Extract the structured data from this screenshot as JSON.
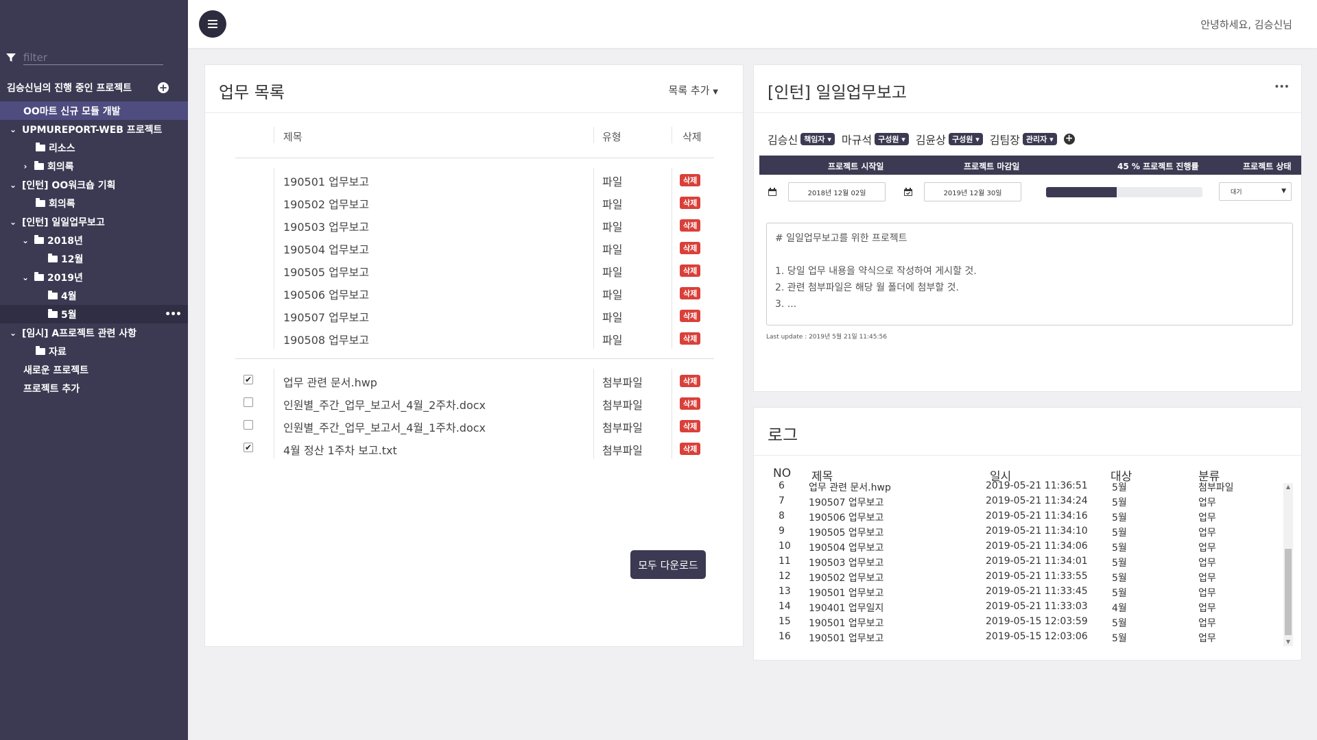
{
  "sidebar": {
    "filter_placeholder": "filter",
    "projects_header": "김승신님의 진행 중인 프로젝트",
    "tree": [
      {
        "label": "OO마트 신규 모듈 개발"
      },
      {
        "label": "UPMUREPORT-WEB 프로젝트"
      },
      {
        "label": "리소스"
      },
      {
        "label": "회의록"
      },
      {
        "label": "[인턴] OO워크숍 기획"
      },
      {
        "label": "회의록"
      },
      {
        "label": "[인턴] 일일업무보고"
      },
      {
        "label": "2018년"
      },
      {
        "label": "12월"
      },
      {
        "label": "2019년"
      },
      {
        "label": "4월"
      },
      {
        "label": "5월"
      },
      {
        "label": "[임시] A프로젝트 관련 사항"
      },
      {
        "label": "자료"
      },
      {
        "label": "새로운 프로젝트"
      },
      {
        "label": "프로젝트 추가"
      }
    ]
  },
  "topbar": {
    "greeting": "안녕하세요, 김승신님"
  },
  "list_panel": {
    "title": "업무 목록",
    "add_label": "목록 추가",
    "columns": {
      "name": "제목",
      "type": "유형",
      "delete": "삭제"
    },
    "delete_label": "삭제",
    "reports": [
      {
        "name": "190501 업무보고",
        "type": "파일"
      },
      {
        "name": "190502 업무보고",
        "type": "파일"
      },
      {
        "name": "190503 업무보고",
        "type": "파일"
      },
      {
        "name": "190504 업무보고",
        "type": "파일"
      },
      {
        "name": "190505 업무보고",
        "type": "파일"
      },
      {
        "name": "190506 업무보고",
        "type": "파일"
      },
      {
        "name": "190507 업무보고",
        "type": "파일"
      },
      {
        "name": "190508 업무보고",
        "type": "파일"
      }
    ],
    "attachments": [
      {
        "name": "업무 관련 문서.hwp",
        "type": "첨부파일",
        "checked": true
      },
      {
        "name": "인원별_주간_업무_보고서_4월_2주차.docx",
        "type": "첨부파일",
        "checked": false
      },
      {
        "name": "인원별_주간_업무_보고서_4월_1주차.docx",
        "type": "첨부파일",
        "checked": false
      },
      {
        "name": "4월 정산 1주차 보고.txt",
        "type": "첨부파일",
        "checked": true
      }
    ],
    "download_all": "모두 다운로드"
  },
  "detail_panel": {
    "title": "[인턴] 일일업무보고",
    "members": [
      {
        "name": "김승신",
        "role": "책임자"
      },
      {
        "name": "마규석",
        "role": "구성원"
      },
      {
        "name": "김윤상",
        "role": "구성원"
      },
      {
        "name": "김팀장",
        "role": "관리자"
      }
    ],
    "info_headers": {
      "start": "프로젝트 시작일",
      "end": "프로젝트 마감일",
      "progress": "45 %  프로젝트 진행률",
      "status": "프로젝트 상태"
    },
    "start_date": "2018년 12월 02일",
    "end_date": "2019년 12월 30일",
    "progress_percent": 45,
    "status_value": "대기",
    "description_lines": [
      "# 일일업무보고를 위한 프로젝트",
      "",
      "1. 당일 업무 내용을 약식으로 작성하여 게시할 것.",
      "2. 관련 첨부파일은 해당 월 폴더에 첨부할 것.",
      "3. ..."
    ],
    "last_update": "Last update : 2019년 5월 21일 11:45:56"
  },
  "log_panel": {
    "title": "로그",
    "headers": {
      "no": "NO",
      "title": "제목",
      "datetime": "일시",
      "target": "대상",
      "category": "분류"
    },
    "rows": [
      {
        "no": "6",
        "title": "업무 관련 문서.hwp",
        "datetime": "2019-05-21 11:36:51",
        "target": "5월",
        "category": "첨부파일"
      },
      {
        "no": "7",
        "title": "190507 업무보고",
        "datetime": "2019-05-21 11:34:24",
        "target": "5월",
        "category": "업무"
      },
      {
        "no": "8",
        "title": "190506 업무보고",
        "datetime": "2019-05-21 11:34:16",
        "target": "5월",
        "category": "업무"
      },
      {
        "no": "9",
        "title": "190505 업무보고",
        "datetime": "2019-05-21 11:34:10",
        "target": "5월",
        "category": "업무"
      },
      {
        "no": "10",
        "title": "190504 업무보고",
        "datetime": "2019-05-21 11:34:06",
        "target": "5월",
        "category": "업무"
      },
      {
        "no": "11",
        "title": "190503 업무보고",
        "datetime": "2019-05-21 11:34:01",
        "target": "5월",
        "category": "업무"
      },
      {
        "no": "12",
        "title": "190502 업무보고",
        "datetime": "2019-05-21 11:33:55",
        "target": "5월",
        "category": "업무"
      },
      {
        "no": "13",
        "title": "190501 업무보고",
        "datetime": "2019-05-21 11:33:45",
        "target": "5월",
        "category": "업무"
      },
      {
        "no": "14",
        "title": "190401 업무일지",
        "datetime": "2019-05-21 11:33:03",
        "target": "4월",
        "category": "업무"
      },
      {
        "no": "15",
        "title": "190501 업무보고",
        "datetime": "2019-05-15 12:03:59",
        "target": "5월",
        "category": "업무"
      },
      {
        "no": "16",
        "title": "190501 업무보고",
        "datetime": "2019-05-15 12:03:06",
        "target": "5월",
        "category": "업무"
      }
    ]
  },
  "colors": {
    "sidebar_bg": "#3b3a52",
    "active_item": "#4f4c80",
    "delete_badge": "#d9403a",
    "accent_dark": "#2d2c3e"
  }
}
